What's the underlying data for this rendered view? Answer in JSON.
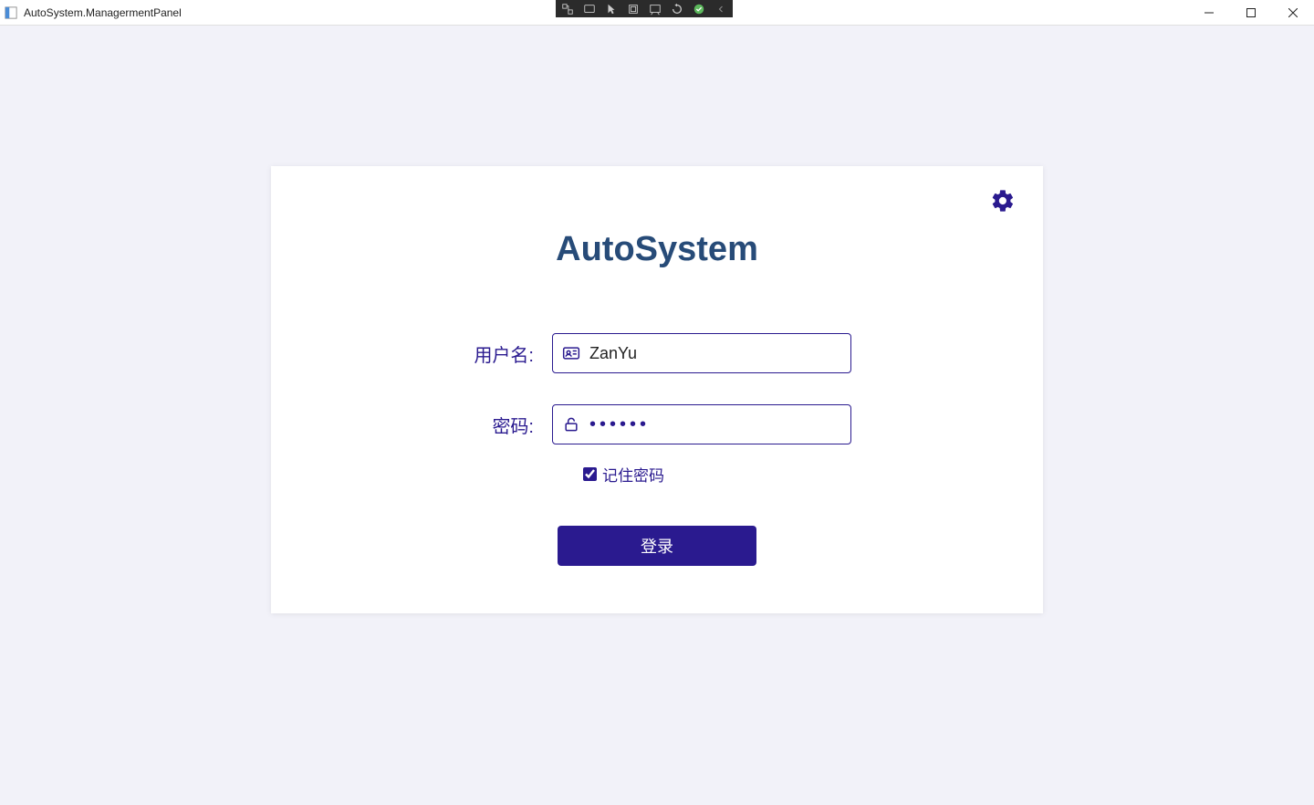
{
  "window": {
    "title": "AutoSystem.ManagermentPanel"
  },
  "login": {
    "app_title": "AutoSystem",
    "username_label": "用户名:",
    "username_value": "ZanYu",
    "password_label": "密码:",
    "password_value": "••••••",
    "remember_label": "记住密码",
    "remember_checked": true,
    "login_button": "登录"
  },
  "colors": {
    "accent": "#2a1a8f",
    "title": "#274b78"
  }
}
